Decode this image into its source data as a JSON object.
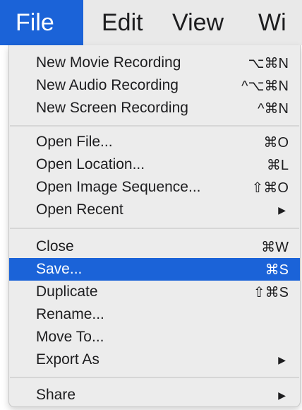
{
  "menubar": {
    "items": [
      {
        "label": "File"
      },
      {
        "label": "Edit"
      },
      {
        "label": "View"
      },
      {
        "label": "Wi"
      }
    ]
  },
  "file_menu": {
    "items": [
      {
        "label": "New Movie Recording",
        "shortcut": "⌥⌘N"
      },
      {
        "label": "New Audio Recording",
        "shortcut": "^⌥⌘N"
      },
      {
        "label": "New Screen Recording",
        "shortcut": "^⌘N"
      },
      {
        "label": "Open File...",
        "shortcut": "⌘O"
      },
      {
        "label": "Open Location...",
        "shortcut": "⌘L"
      },
      {
        "label": "Open Image Sequence...",
        "shortcut": "⇧⌘O"
      },
      {
        "label": "Open Recent",
        "shortcut": "▶"
      },
      {
        "label": "Close",
        "shortcut": "⌘W"
      },
      {
        "label": "Save...",
        "shortcut": "⌘S"
      },
      {
        "label": "Duplicate",
        "shortcut": "⇧⌘S"
      },
      {
        "label": "Rename...",
        "shortcut": ""
      },
      {
        "label": "Move To...",
        "shortcut": ""
      },
      {
        "label": "Export As",
        "shortcut": "▶"
      },
      {
        "label": "Share",
        "shortcut": "▶"
      }
    ],
    "highlighted": "Save..."
  },
  "colors": {
    "accent": "#1b63d8",
    "menu_background": "#ececec",
    "menubar_background": "#e9e9e9"
  }
}
